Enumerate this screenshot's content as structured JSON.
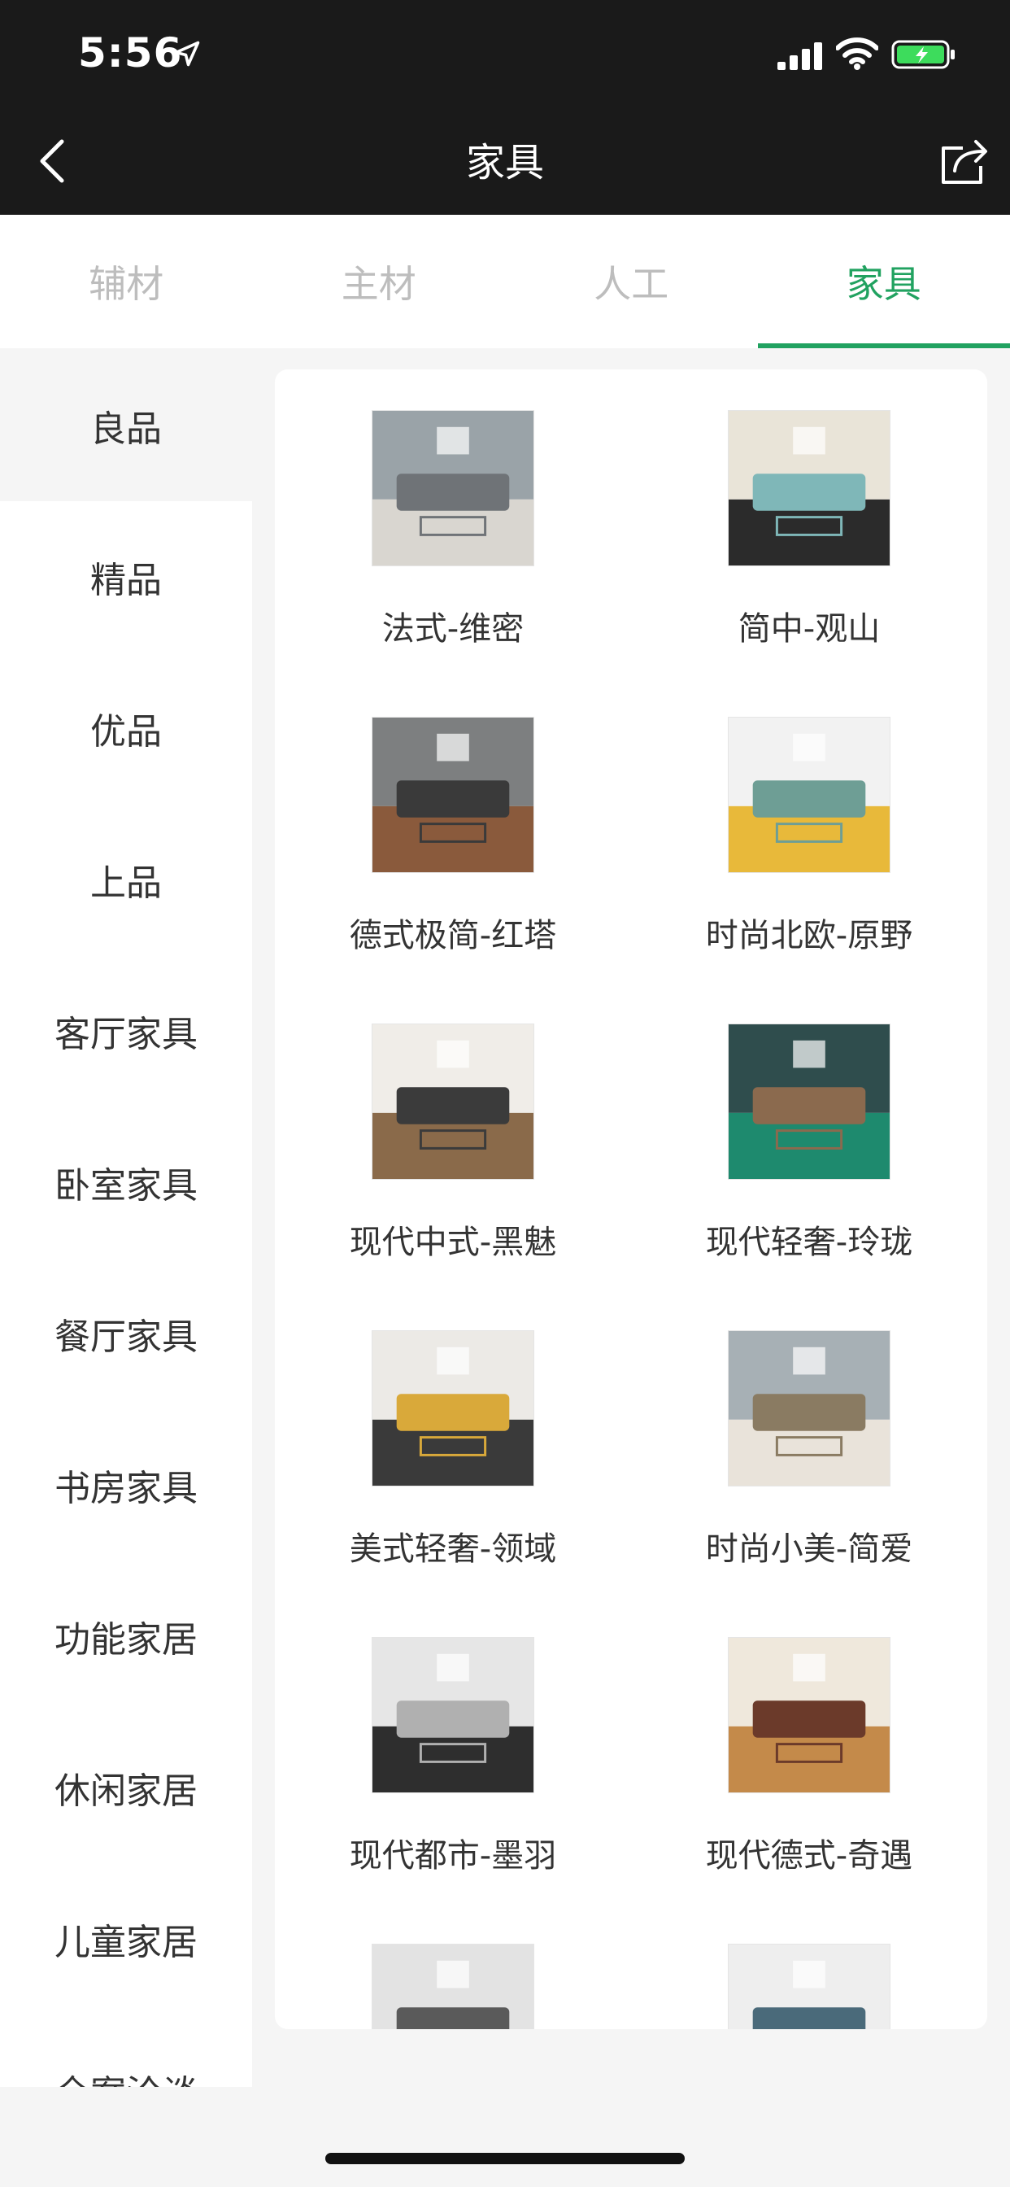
{
  "status_bar": {
    "time": "5:56"
  },
  "nav": {
    "title": "家具"
  },
  "tabs": [
    {
      "label": "辅材",
      "active": false
    },
    {
      "label": "主材",
      "active": false
    },
    {
      "label": "人工",
      "active": false
    },
    {
      "label": "家具",
      "active": true
    }
  ],
  "colors": {
    "accent": "#21a260",
    "topbar": "#1a1a1a",
    "battery": "#3ddc5c"
  },
  "sidebar": {
    "items": [
      {
        "label": "良品",
        "active": true
      },
      {
        "label": "精品"
      },
      {
        "label": "优品"
      },
      {
        "label": "上品"
      },
      {
        "label": "客厅家具"
      },
      {
        "label": "卧室家具"
      },
      {
        "label": "餐厅家具"
      },
      {
        "label": "书房家具"
      },
      {
        "label": "功能家居"
      },
      {
        "label": "休闲家居"
      },
      {
        "label": "儿童家居"
      },
      {
        "label": "全案洽谈"
      }
    ]
  },
  "products": [
    {
      "label": "法式-维密"
    },
    {
      "label": "简中-观山"
    },
    {
      "label": "德式极简-红塔"
    },
    {
      "label": "时尚北欧-原野"
    },
    {
      "label": "现代中式-黑魅"
    },
    {
      "label": "现代轻奢-玲珑"
    },
    {
      "label": "美式轻奢-领域"
    },
    {
      "label": "时尚小美-简爱"
    },
    {
      "label": "现代都市-墨羽"
    },
    {
      "label": "现代德式-奇遇"
    },
    {
      "label": ""
    },
    {
      "label": ""
    }
  ]
}
